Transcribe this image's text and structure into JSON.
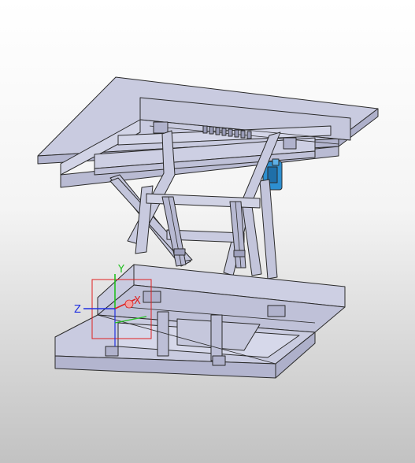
{
  "viewport": {
    "background_top": "#ffffff",
    "background_bottom": "#c2c2c2"
  },
  "model": {
    "name": "scissor-lift-table-assembly",
    "face_color": "#c9cbe0",
    "dark_face_color": "#a9abc6",
    "edge_color": "#2b2b2b",
    "motor_color": "#2d8fd0"
  },
  "triad": {
    "x_label": "X",
    "y_label": "Y",
    "z_label": "Z",
    "x_color": "#e02020",
    "y_color": "#22c020",
    "z_color": "#2030e0"
  }
}
